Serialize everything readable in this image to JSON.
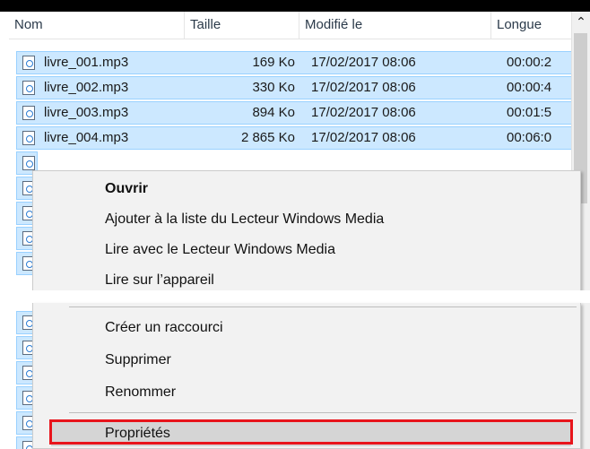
{
  "header": {
    "columns": [
      "Nom",
      "Taille",
      "Modifié le",
      "Longue"
    ]
  },
  "files": [
    {
      "name": "livre_001.mp3",
      "size": "169 Ko",
      "modified": "17/02/2017 08:06",
      "length": "00:00:2"
    },
    {
      "name": "livre_002.mp3",
      "size": "330 Ko",
      "modified": "17/02/2017 08:06",
      "length": "00:00:4"
    },
    {
      "name": "livre_003.mp3",
      "size": "894 Ko",
      "modified": "17/02/2017 08:06",
      "length": "00:01:5"
    },
    {
      "name": "livre_004.mp3",
      "size": "2 865 Ko",
      "modified": "17/02/2017 08:06",
      "length": "00:06:0"
    }
  ],
  "menu_top": {
    "items": [
      "Ouvrir",
      "Ajouter à la liste du Lecteur Windows Media",
      "Lire avec le Lecteur Windows Media",
      "Lire sur l’appareil"
    ]
  },
  "menu_bottom": {
    "items": [
      "Créer un raccourci",
      "Supprimer",
      "Renommer",
      "Propriétés"
    ]
  },
  "colors": {
    "selection": "#cce8ff",
    "selection_border": "#99d1ff",
    "highlight": "#e8141b"
  }
}
